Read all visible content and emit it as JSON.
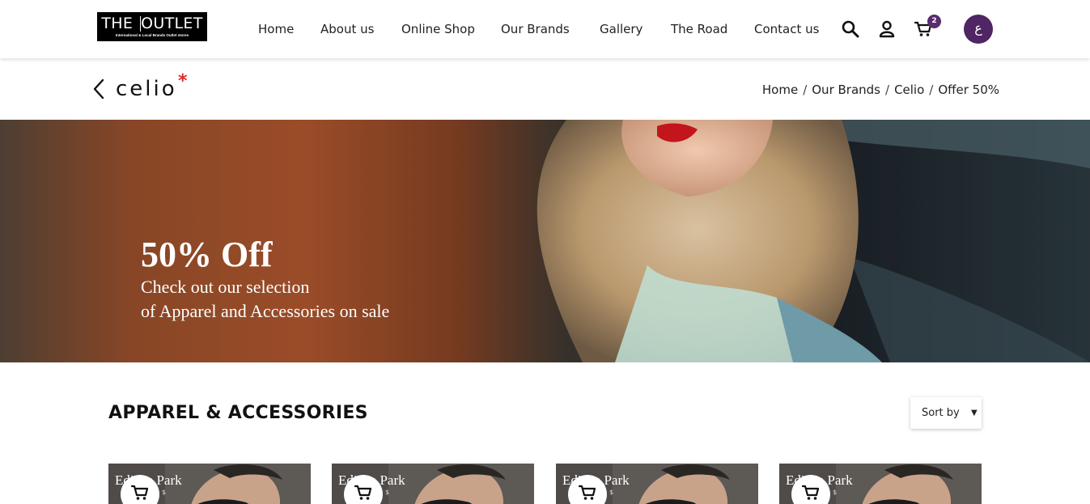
{
  "logo": {
    "main_left": "THE",
    "main_right": "OUTLET",
    "tagline": "International & Local Brands Outlet stores"
  },
  "nav": {
    "items": [
      "Home",
      "About us",
      "Online Shop",
      "Our Brands",
      "Gallery",
      "The Road",
      "Contact us"
    ]
  },
  "header_icons": {
    "search": "search-icon",
    "account": "user-icon",
    "cart": "cart-icon",
    "cart_count": "2",
    "language_label": "ع"
  },
  "brand": {
    "name": "celio",
    "mark": "*"
  },
  "breadcrumb": [
    "Home",
    "Our Brands",
    "Celio",
    "Offer 50%"
  ],
  "hero": {
    "title": "50% Off",
    "subtitle_line1": "Check out our selection",
    "subtitle_line2": "of Apparel and Accessories on sale"
  },
  "section": {
    "title": "APPAREL & ACCESSORIES",
    "sort_label": "Sort by"
  },
  "products": [
    {
      "brand": "Edison Park",
      "price": "$"
    },
    {
      "brand": "Edison Park",
      "price": "$"
    },
    {
      "brand": "Edison Park",
      "price": "$"
    },
    {
      "brand": "Edison Park",
      "price": "$"
    }
  ],
  "colors": {
    "accent_purple": "#4f2563",
    "badge_purple": "#5a2b6e",
    "brand_star_red": "#e4262a"
  }
}
